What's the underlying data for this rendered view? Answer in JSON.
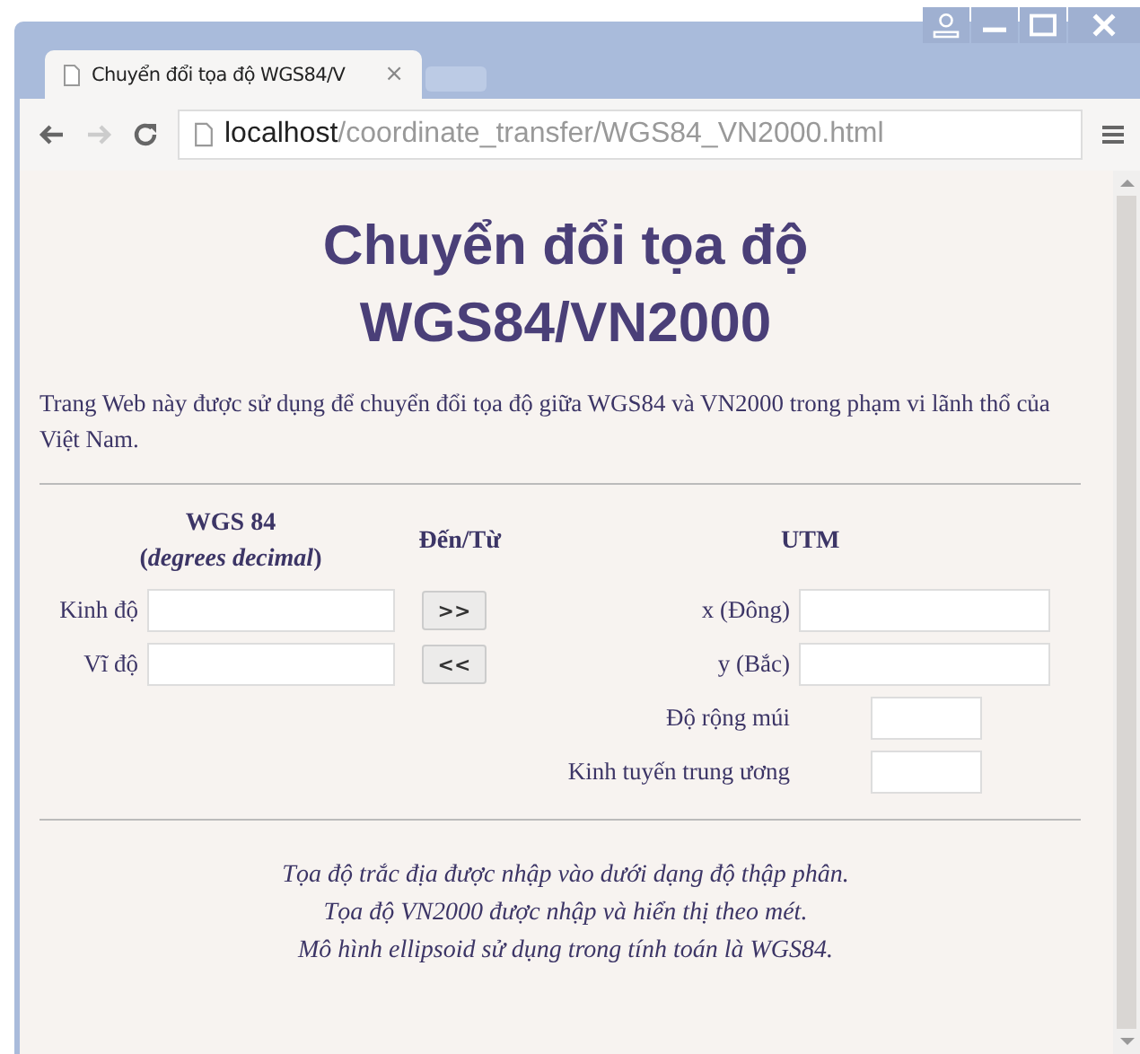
{
  "browser": {
    "tab": {
      "title": "Chuyển đổi tọa độ WGS84/V",
      "close": "×"
    },
    "address": {
      "host": "localhost",
      "path": "/coordinate_transfer/WGS84_VN2000.html"
    }
  },
  "page": {
    "title_lines": [
      "Chuyển đổi tọa độ",
      "WGS84/VN2000"
    ],
    "intro": "Trang Web này được sử dụng để chuyển đổi tọa độ giữa WGS84 và VN2000 trong phạm vi lãnh thổ của Việt Nam.",
    "headers": {
      "wgs": "WGS 84",
      "wgs_unit": "(*degrees decimal*)",
      "direction": "Đến/Từ",
      "utm": "UTM"
    },
    "rows": [
      {
        "label": "Kinh độ",
        "button": ">>",
        "utm_label": "x (Đông)"
      },
      {
        "label": "Vĩ độ",
        "button": "<<",
        "utm_label": "y (Bắc)"
      }
    ],
    "extra_fields": [
      {
        "label": "Độ rộng múi"
      },
      {
        "label": "Kinh tuyến trung ương"
      }
    ],
    "notes": [
      "Tọa độ trắc địa được nhập vào dưới dạng độ thập phân.",
      "Tọa độ VN2000 được nhập và hiển thị theo mét.",
      "Mô hình ellipsoid sử dụng trong tính toán là WGS84."
    ]
  }
}
